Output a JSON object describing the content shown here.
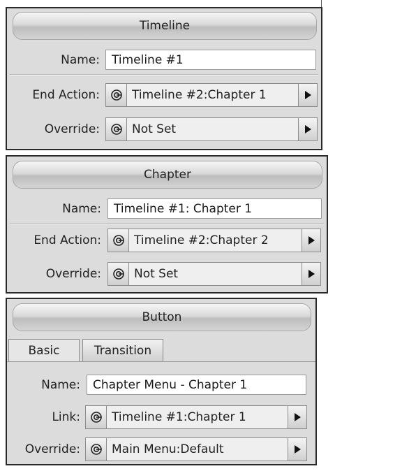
{
  "timeline_panel": {
    "title": "Timeline",
    "name_label": "Name:",
    "name_value": "Timeline #1",
    "end_action_label": "End Action:",
    "end_action_value": "Timeline #2:Chapter 1",
    "override_label": "Override:",
    "override_value": "Not Set"
  },
  "chapter_panel": {
    "title": "Chapter",
    "name_label": "Name:",
    "name_value": "Timeline #1: Chapter 1",
    "end_action_label": "End Action:",
    "end_action_value": "Timeline #2:Chapter 2",
    "override_label": "Override:",
    "override_value": "Not Set"
  },
  "button_panel": {
    "title": "Button",
    "tabs": [
      {
        "label": "Basic",
        "active": true
      },
      {
        "label": "Transition",
        "active": false
      }
    ],
    "name_label": "Name:",
    "name_value": "Chapter Menu - Chapter 1",
    "link_label": "Link:",
    "link_value": "Timeline #1:Chapter 1",
    "override_label": "Override:",
    "override_value": "Main Menu:Default"
  },
  "icons": {
    "target_icon": "target-icon",
    "arrow_icon": "play-arrow-icon"
  },
  "colors": {
    "panel_bg": "#dcdcdc",
    "panel_border": "#2a2a2a",
    "field_bg": "#ffffff"
  }
}
